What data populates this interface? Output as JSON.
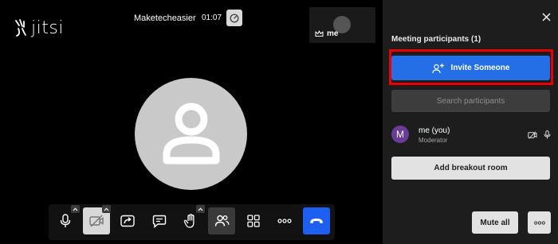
{
  "app": {
    "logo_text": "jitsi"
  },
  "header": {
    "meeting_title": "Maketecheasier",
    "timer": "01:07"
  },
  "thumbnail": {
    "label": "me"
  },
  "toolbar": {
    "buttons": [
      {
        "id": "microphone",
        "icon": "microphone-icon"
      },
      {
        "id": "camera",
        "icon": "camera-off-icon"
      },
      {
        "id": "share-screen",
        "icon": "share-screen-icon"
      },
      {
        "id": "chat",
        "icon": "chat-icon"
      },
      {
        "id": "raise-hand",
        "icon": "raise-hand-icon"
      },
      {
        "id": "participants",
        "icon": "participants-icon"
      },
      {
        "id": "tile-view",
        "icon": "tile-view-icon"
      },
      {
        "id": "more",
        "icon": "more-icon"
      },
      {
        "id": "leave",
        "icon": "hangup-icon"
      }
    ]
  },
  "panel": {
    "title": "Meeting participants (1)",
    "invite_label": "Invite Someone",
    "search_placeholder": "Search participants",
    "participants": [
      {
        "initial": "M",
        "name": "me (you)",
        "role": "Moderator"
      }
    ],
    "breakout_label": "Add breakout room",
    "mute_all_label": "Mute all"
  },
  "colors": {
    "invite_button": "#246fe5",
    "highlight_outline": "#ee0000",
    "hangup_button": "#1d5ff0",
    "participant_avatar": "#6a3b97"
  }
}
